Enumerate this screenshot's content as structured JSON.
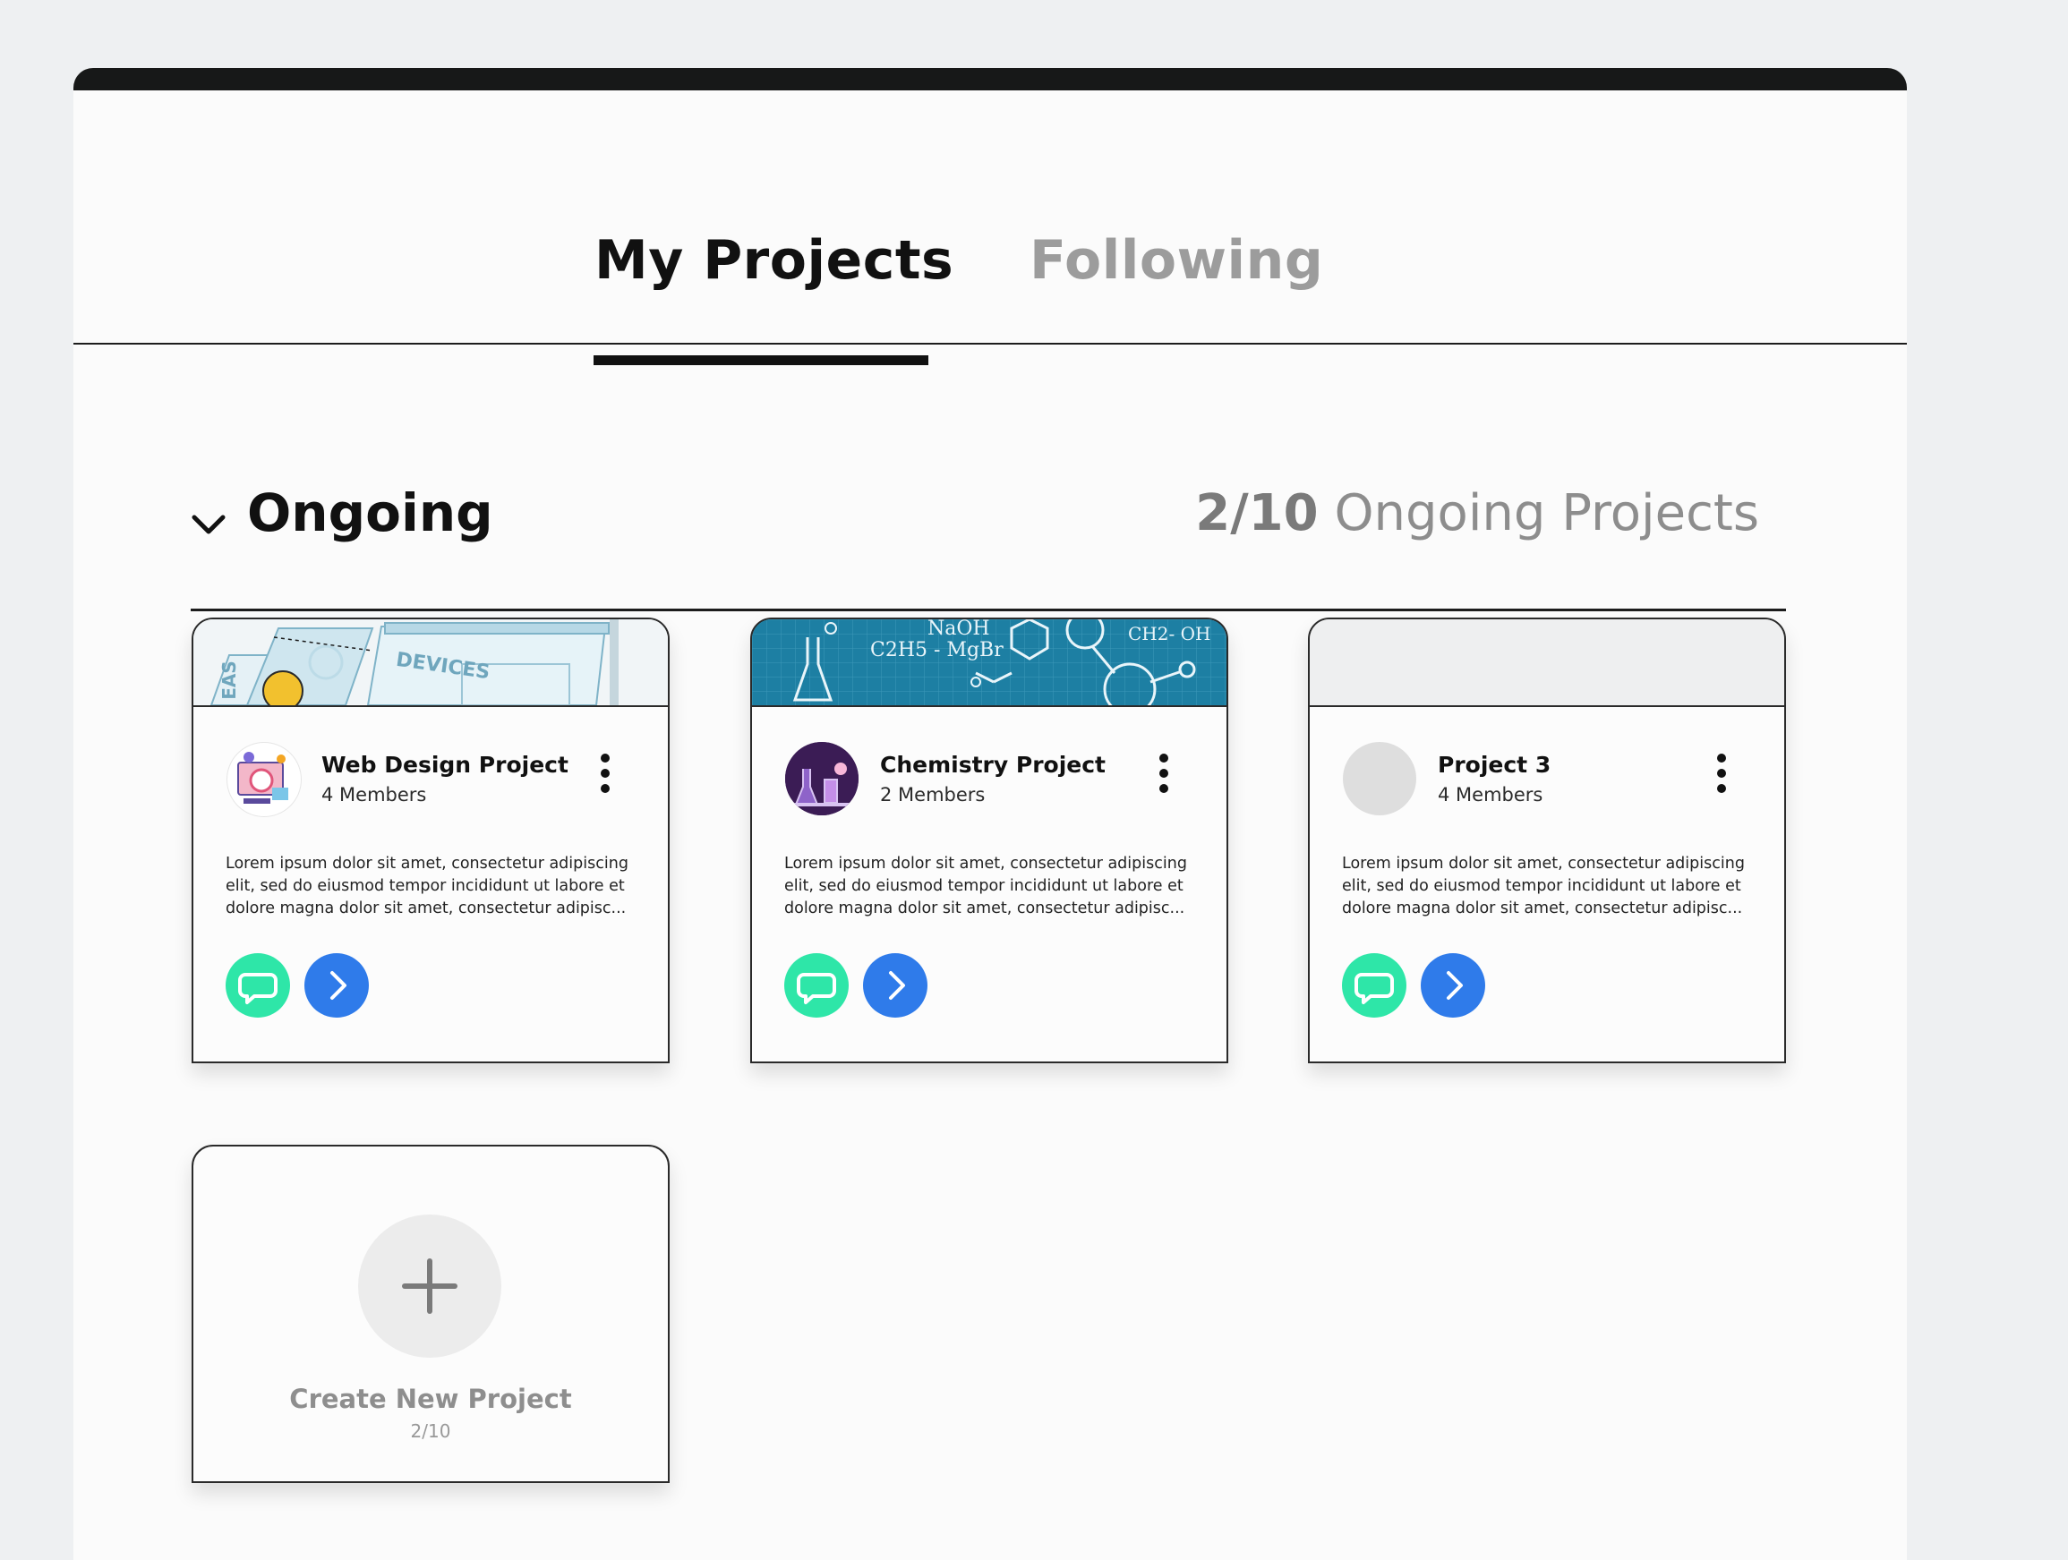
{
  "tabs": [
    {
      "label": "My Projects",
      "active": true
    },
    {
      "label": "Following",
      "active": false
    }
  ],
  "section": {
    "title": "Ongoing",
    "count_current": "2/10",
    "count_label": "Ongoing Projects",
    "toggle_icon": "chevron-down-icon"
  },
  "banner_text": {
    "web": {
      "ideas": "EAS",
      "devices": "DEVICES"
    },
    "chem": {
      "naoh": "NaOH",
      "grignard": "C2H5 - MgBr",
      "ch2oh": "CH2- OH"
    }
  },
  "projects": [
    {
      "title": "Web Design Project",
      "members": "4 Members",
      "description": "Lorem ipsum dolor sit amet, consectetur adipiscing elit, sed do eiusmod tempor incididunt ut labore et dolore magna dolor sit amet, consectetur adipisc...",
      "banner": "web-design-illustration",
      "avatar": "web-design-avatar"
    },
    {
      "title": "Chemistry Project",
      "members": "2 Members",
      "description": "Lorem ipsum dolor sit amet, consectetur adipiscing elit, sed do eiusmod tempor incididunt ut labore et dolore magna dolor sit amet, consectetur adipisc...",
      "banner": "chemistry-illustration",
      "avatar": "chemistry-avatar"
    },
    {
      "title": "Project 3",
      "members": "4 Members",
      "description": "Lorem ipsum dolor sit amet, consectetur adipiscing elit, sed do eiusmod tempor incididunt ut labore et dolore magna dolor sit amet, consectetur adipisc...",
      "banner": "empty",
      "avatar": "placeholder"
    }
  ],
  "create": {
    "label": "Create New Project",
    "count": "2/10",
    "icon": "plus-icon"
  },
  "colors": {
    "chat_button": "#2ee6a8",
    "open_button": "#2f7bea",
    "chem_banner": "#1d7fa3",
    "muted_text": "#8e8e8e"
  }
}
